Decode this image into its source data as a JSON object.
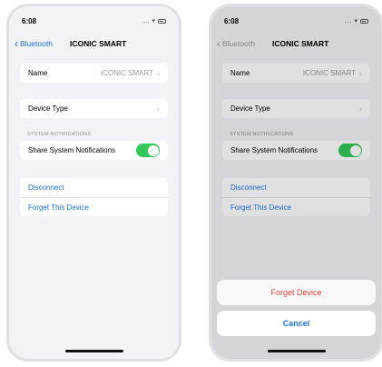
{
  "status": {
    "time": "6:08",
    "signal": "....",
    "wifi": "▾"
  },
  "nav": {
    "back_label": "Bluetooth",
    "title": "ICONIC SMART"
  },
  "rows": {
    "name_label": "Name",
    "name_value": "ICONIC SMART",
    "device_type_label": "Device Type",
    "section_header": "SYSTEM NOTIFICATIONS",
    "share_label": "Share System Notifications",
    "share_enabled": true,
    "disconnect": "Disconnect",
    "forget": "Forget This Device"
  },
  "sheet": {
    "forget_device": "Forget Device",
    "cancel": "Cancel"
  },
  "colors": {
    "link": "#1a73e8",
    "toggle_on": "#34c759",
    "destructive": "#e5433b"
  }
}
